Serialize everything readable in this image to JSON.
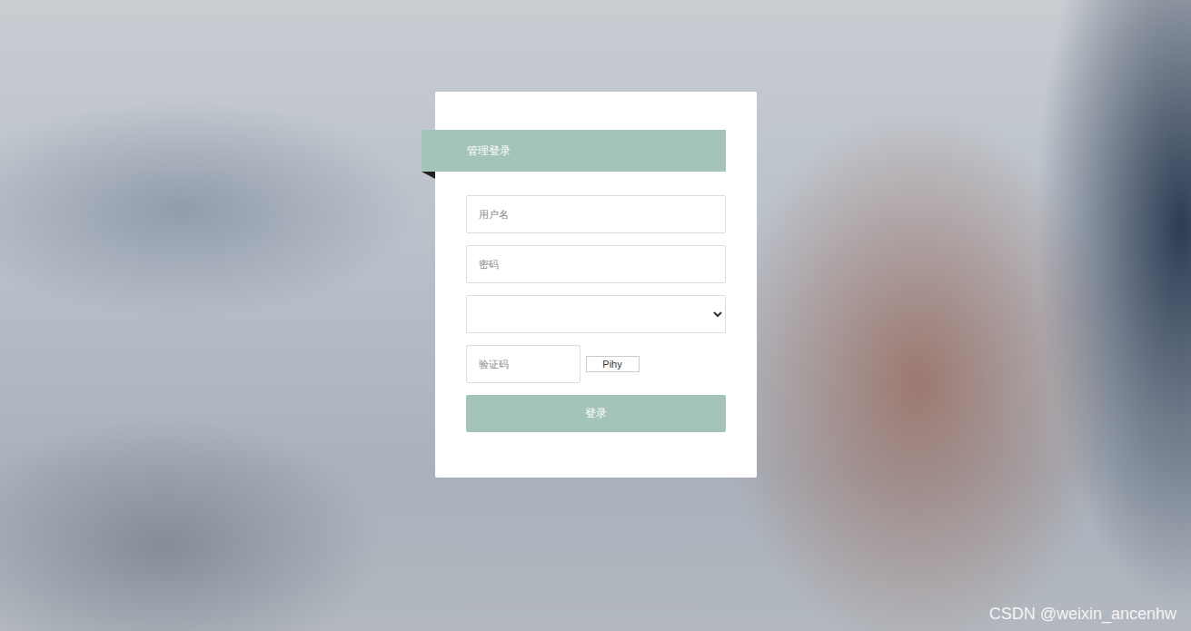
{
  "title": "管理登录",
  "fields": [
    {
      "kind": "text",
      "placeholder": "用户名"
    },
    {
      "kind": "password",
      "placeholder": "密码"
    },
    {
      "kind": "select"
    }
  ],
  "captcha": {
    "placeholder": "验证码",
    "code": "Pihy"
  },
  "button": "登录",
  "watermark": "CSDN @weixin_ancenhw"
}
